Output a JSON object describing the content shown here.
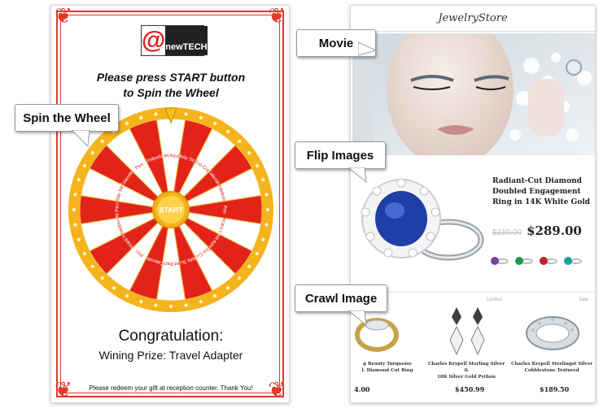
{
  "wheel_screen": {
    "logo": {
      "at": "@",
      "name": "newTECH"
    },
    "instruction_line1": "Please press START button",
    "instruction_line2": "to Spin the Wheel",
    "start_label": "START",
    "segments": [
      "Travel Adapter",
      "Mobile Stand",
      "Eco Cup",
      "Calender",
      "Notebook",
      "Pen",
      "Namecard Holder",
      "Travel Adapter",
      "Eco Cup",
      "Mobile Stand",
      "Red Packet",
      "Calender",
      "Pen",
      "Namecard Holder",
      "Notebook",
      "Red Packet",
      "Mobile Stand",
      "Calender",
      "Pen",
      "Umbrella"
    ],
    "congrats": "Congratulation:",
    "prize": "Wining Prize: Travel Adapter",
    "redeem": "Please redeem your gift at reception counter. Thank You!",
    "colors": {
      "red": "#e2231a",
      "gold": "#f5b31c",
      "frame": "#e23a2a"
    }
  },
  "store_screen": {
    "store_name": "JewelryStore",
    "product": {
      "title": "Radiant-Cut Diamond Doubled Engagement Ring in 14K White Gold",
      "old_price": "$310.00",
      "price": "$289.00",
      "swatch_colors": [
        "#7b3fa0",
        "#1f9a4a",
        "#c41f2c",
        "#1aa39a"
      ]
    },
    "crawl_items": [
      {
        "name": "g Beauty Turquoise\nl. Diamond Cut Ring",
        "price": "4.00",
        "tag": ""
      },
      {
        "name": "Charles Krypell Sterling Silver &\n18K Silver Gold Python",
        "price": "$450.99",
        "tag": "Limited"
      },
      {
        "name": "Charles Krypell Sterlingst Silver\nCobblestone Textured",
        "price": "$189.50",
        "tag": "Sale"
      }
    ]
  },
  "callouts": {
    "spin": "Spin the Wheel",
    "movie": "Movie",
    "flip": "Flip Images",
    "crawl": "Crawl Image"
  }
}
